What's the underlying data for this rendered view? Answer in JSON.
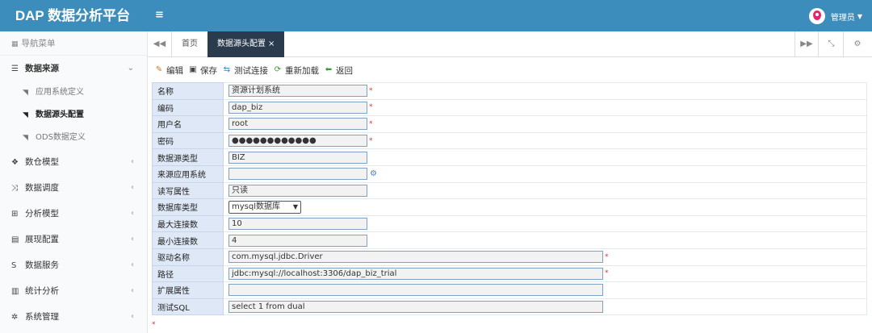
{
  "app": {
    "title": "DAP 数据分析平台"
  },
  "header": {
    "user_name": "管理员"
  },
  "sidebar": {
    "heading": "导航菜单",
    "items": [
      {
        "label": "数据来源",
        "icon": "database-icon",
        "open": true,
        "children": [
          {
            "label": "应用系统定义",
            "active": false
          },
          {
            "label": "数据源头配置",
            "active": true
          },
          {
            "label": "ODS数据定义",
            "active": false
          }
        ]
      },
      {
        "label": "数仓模型",
        "icon": "cubes-icon"
      },
      {
        "label": "数据调度",
        "icon": "random-icon"
      },
      {
        "label": "分析模型",
        "icon": "sitemap-icon"
      },
      {
        "label": "展现配置",
        "icon": "film-icon"
      },
      {
        "label": "数据服务",
        "icon": "dollar-icon"
      },
      {
        "label": "统计分析",
        "icon": "bar-chart-icon"
      },
      {
        "label": "系统管理",
        "icon": "gear-icon"
      }
    ]
  },
  "tabs": [
    {
      "label": "首页",
      "active": false
    },
    {
      "label": "数据源头配置",
      "active": true,
      "close": "×"
    }
  ],
  "toolbar": {
    "edit": "编辑",
    "save": "保存",
    "test": "测试连接",
    "reload": "重新加载",
    "back": "返回"
  },
  "form": [
    {
      "label": "名称",
      "value": "资源计划系统",
      "required": true,
      "width": "short"
    },
    {
      "label": "编码",
      "value": "dap_biz",
      "required": true,
      "width": "short"
    },
    {
      "label": "用户名",
      "value": "root",
      "required": true,
      "width": "short"
    },
    {
      "label": "密码",
      "value": "●●●●●●●●●●●●",
      "required": true,
      "width": "short"
    },
    {
      "label": "数据源类型",
      "value": "BIZ",
      "required": false,
      "width": "short"
    },
    {
      "label": "来源应用系统",
      "value": "",
      "required": false,
      "width": "short",
      "picker": true
    },
    {
      "label": "读写属性",
      "value": "只读",
      "required": false,
      "width": "short"
    },
    {
      "label": "数据库类型",
      "value": "mysql数据库",
      "required": false,
      "select": true
    },
    {
      "label": "最大连接数",
      "value": "10",
      "required": false,
      "width": "short"
    },
    {
      "label": "最小连接数",
      "value": "4",
      "required": false,
      "width": "short"
    },
    {
      "label": "驱动名称",
      "value": "com.mysql.jdbc.Driver",
      "required": true,
      "width": "long"
    },
    {
      "label": "路径",
      "value": "jdbc:mysql://localhost:3306/dap_biz_trial",
      "required": true,
      "width": "long"
    },
    {
      "label": "扩展属性",
      "value": "",
      "required": false,
      "width": "long"
    },
    {
      "label": "测试SQL",
      "value": "select 1 from dual",
      "required": false,
      "width": "long"
    }
  ],
  "required_mark": "*"
}
